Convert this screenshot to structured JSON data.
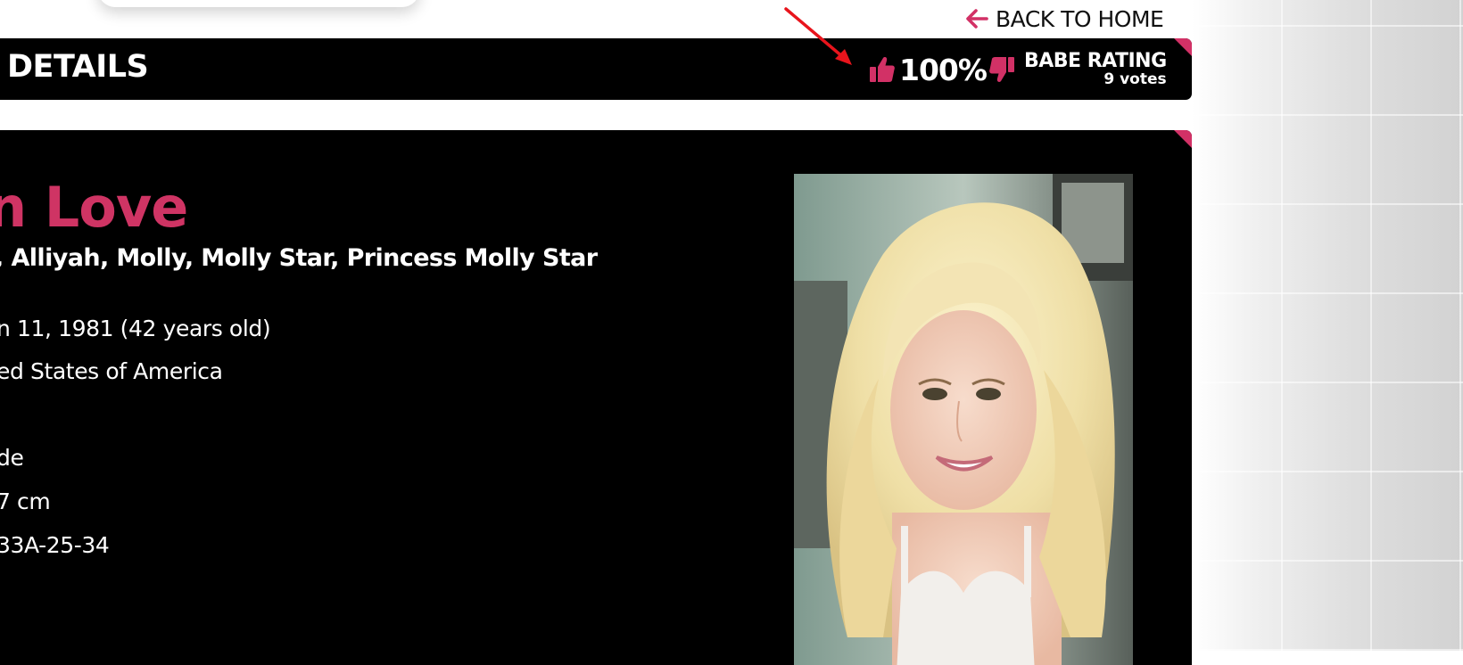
{
  "nav": {
    "back_home_label": "BACK TO HOME"
  },
  "header": {
    "title": "DETAILS",
    "rating": {
      "percent_label": "100%",
      "title": "BABE RATING",
      "votes_label": "9 votes"
    }
  },
  "profile": {
    "name_visible": "n Love",
    "aliases_visible": ", Alliyah, Molly, Molly Star, Princess Molly Star",
    "details": [
      "n 11, 1981 (42 years old)",
      "ed States of America",
      "de",
      "7 cm",
      "33A-25-34"
    ]
  },
  "colors": {
    "accent_pink": "#d23166",
    "name_pink": "#cf3464",
    "annotation_red": "#e8141c"
  },
  "icons": {
    "back": "arrow-left-icon",
    "thumbs_up": "thumbs-up-icon",
    "thumbs_down": "thumbs-down-icon"
  }
}
